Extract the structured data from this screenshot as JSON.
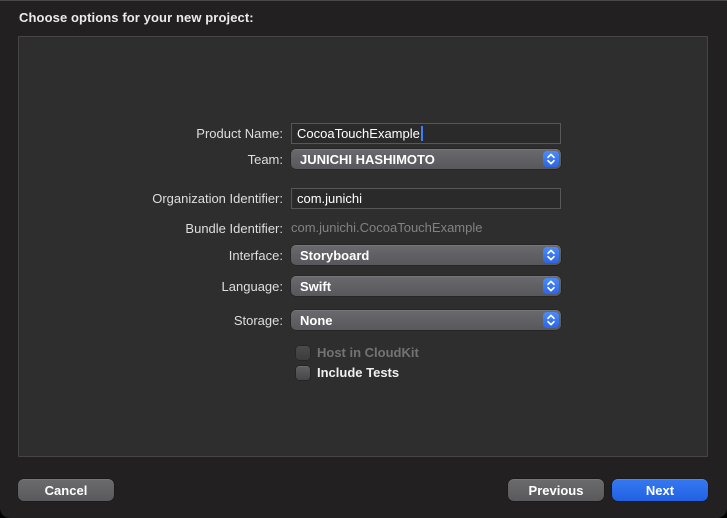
{
  "window": {
    "title": "Choose options for your new project:"
  },
  "form": {
    "product_name": {
      "label": "Product Name:",
      "value": "CocoaTouchExample"
    },
    "team": {
      "label": "Team:",
      "value": "JUNICHI HASHIMOTO"
    },
    "organization_identifier": {
      "label": "Organization Identifier:",
      "value": "com.junichi"
    },
    "bundle_identifier": {
      "label": "Bundle Identifier:",
      "value": "com.junichi.CocoaTouchExample"
    },
    "interface": {
      "label": "Interface:",
      "value": "Storyboard"
    },
    "language": {
      "label": "Language:",
      "value": "Swift"
    },
    "storage": {
      "label": "Storage:",
      "value": "None"
    },
    "host_in_cloudkit": {
      "label": "Host in CloudKit",
      "checked": false,
      "disabled": true
    },
    "include_tests": {
      "label": "Include Tests",
      "checked": false,
      "disabled": false
    }
  },
  "buttons": {
    "cancel": "Cancel",
    "previous": "Previous",
    "next": "Next"
  },
  "colors": {
    "accent_blue": "#2e6ee8",
    "next_button_blue": "#2667e8",
    "panel_background": "#2e2e2f",
    "window_background": "#232021"
  }
}
